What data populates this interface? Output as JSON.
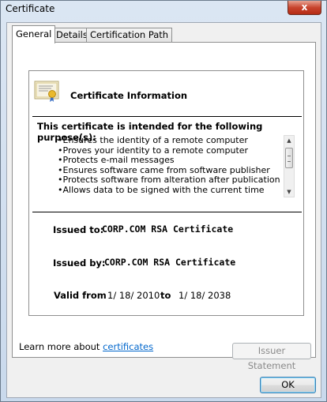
{
  "window": {
    "title": "Certificate",
    "close_label": "x"
  },
  "tabs": [
    {
      "label": "General"
    },
    {
      "label": "Details"
    },
    {
      "label": "Certification Path"
    }
  ],
  "general": {
    "heading": "Certificate Information",
    "purpose_heading": "This certificate is intended for the following purpose(s):",
    "purposes": [
      "Ensures the identity of a remote computer",
      "Proves your identity to a remote computer",
      "Protects e-mail messages",
      "Ensures software came from software publisher",
      "Protects software from alteration after publication",
      "Allows data to be signed with the current time"
    ],
    "issued_to_label": "Issued to:",
    "issued_to_value": "CORP.COM RSA Certificate",
    "issued_by_label": "Issued by:",
    "issued_by_value": "CORP.COM RSA Certificate",
    "valid_from_label": "Valid from",
    "valid_from_value": "1/ 18/ 2010",
    "valid_to_label": "to",
    "valid_to_value": "1/ 18/ 2038"
  },
  "buttons": {
    "issuer_statement": "Issuer Statement",
    "ok": "OK"
  },
  "learn_more": {
    "prefix": "Learn more about ",
    "link": "certificates"
  },
  "colors": {
    "link": "#0066cc",
    "close_button": "#c8452e"
  }
}
